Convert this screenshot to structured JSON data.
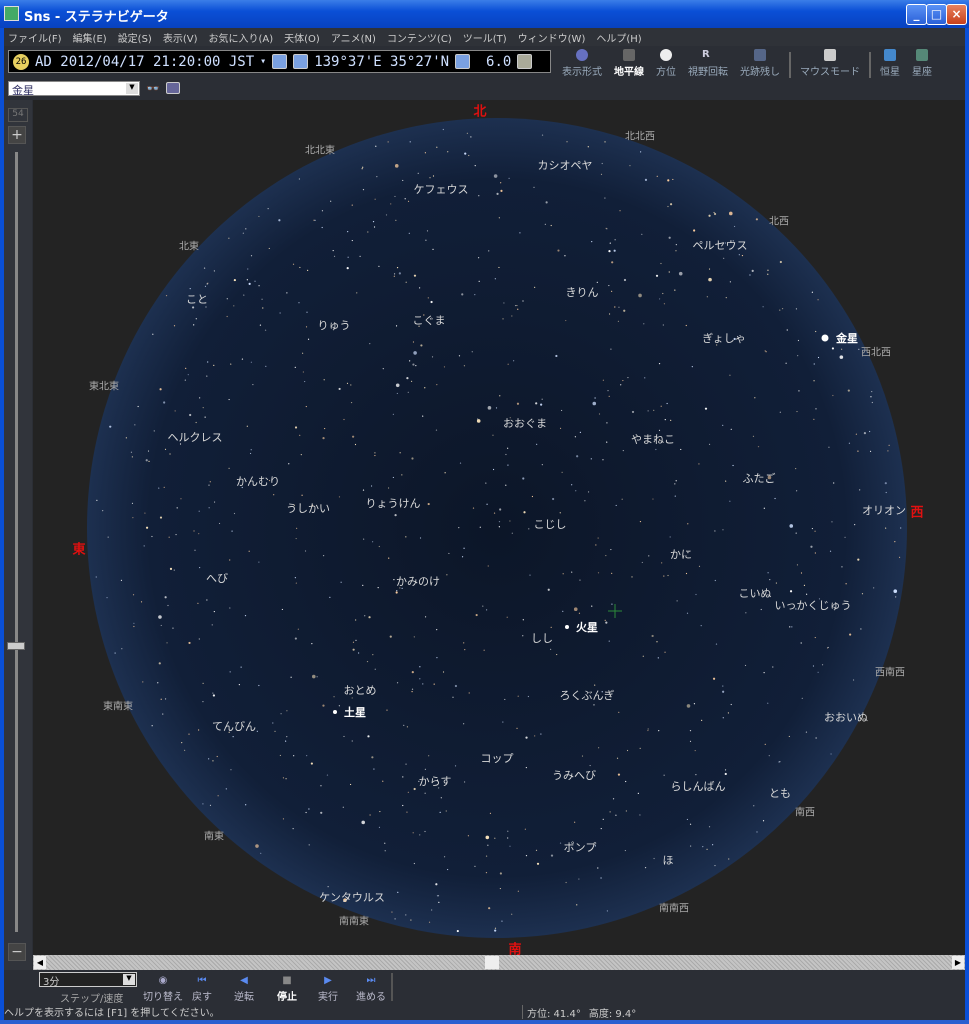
{
  "window": {
    "title": "Sns - ステラナビゲータ",
    "min": "_",
    "max": "□",
    "close": "×"
  },
  "menu": [
    "ファイル(F)",
    "編集(E)",
    "設定(S)",
    "表示(V)",
    "お気に入り(A)",
    "天体(O)",
    "アニメ(N)",
    "コンテンツ(C)",
    "ツール(T)",
    "ウィンドウ(W)",
    "ヘルプ(H)"
  ],
  "info": {
    "moon_age": "26",
    "datetime": "AD 2012/04/17 21:20:00 JST",
    "tz_arrow": "▾",
    "location": "139°37'E 35°27'N",
    "magnitude": "6.0"
  },
  "toolbar": [
    "表示形式",
    "地平線",
    "方位",
    "視野回転",
    "光跡残し",
    "マウスモード",
    "恒星",
    "星座"
  ],
  "object_select": {
    "value": "金星",
    "arrow": "▼"
  },
  "zoom": {
    "value": "54",
    "in": "+",
    "out": "−",
    "level": 0.56
  },
  "cardinals": {
    "n": "北",
    "s": "南",
    "e": "東",
    "w": "西"
  },
  "directions": [
    "北北西",
    "北北東",
    "北西",
    "北東",
    "西北西",
    "東北東",
    "西南西",
    "東南東",
    "南西",
    "南東",
    "南南西",
    "南南東"
  ],
  "constellations": [
    "カシオペヤ",
    "ケフェウス",
    "ペルセウス",
    "きりん",
    "こと",
    "りゅう",
    "こぐま",
    "ぎょしゃ",
    "おおぐま",
    "ヘルクレス",
    "やまねこ",
    "ふたご",
    "かんむり",
    "うしかい",
    "りょうけん",
    "オリオン",
    "こじし",
    "かに",
    "へび",
    "かみのけ",
    "こいぬ",
    "いっかくじゅう",
    "しし",
    "おとめ",
    "ろくぶんぎ",
    "てんびん",
    "おおいぬ",
    "コップ",
    "うみへび",
    "からす",
    "らしんばん",
    "とも",
    "ポンプ",
    "ほ",
    "ケンタウルス"
  ],
  "planets": [
    "金星",
    "火星",
    "土星"
  ],
  "playback": {
    "step": "3分",
    "step_label": "ステップ/速度",
    "buttons": [
      "切り替え",
      "戻す",
      "逆転",
      "停止",
      "実行",
      "進める"
    ]
  },
  "status": {
    "help": "ヘルプを表示するには [F1] を押してください。",
    "azimuth": "方位:  41.4°",
    "altitude": "高度:   9.4°"
  },
  "colors": {
    "cardinal": "#e01010",
    "sky": "#0f1d33"
  }
}
